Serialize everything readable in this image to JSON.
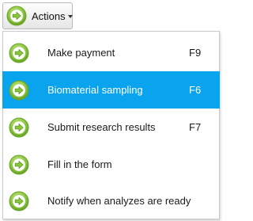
{
  "actions_button": {
    "label": "Actions",
    "icon": "arrow-right-circle-icon"
  },
  "menu": {
    "items": [
      {
        "label": "Make payment",
        "shortcut": "F9",
        "icon": "arrow-right-circle-icon",
        "highlighted": false
      },
      {
        "label": "Biomaterial sampling",
        "shortcut": "F6",
        "icon": "arrow-right-circle-icon",
        "highlighted": true
      },
      {
        "label": "Submit research results",
        "shortcut": "F7",
        "icon": "arrow-right-circle-icon",
        "highlighted": false
      },
      {
        "label": "Fill in the form",
        "shortcut": "",
        "icon": "arrow-right-circle-icon",
        "highlighted": false
      },
      {
        "label": "Notify when analyzes are ready",
        "shortcut": "",
        "icon": "arrow-right-circle-icon",
        "highlighted": false
      }
    ]
  },
  "colors": {
    "highlight": "#0aa3ee",
    "icon_green": "#8cc63f",
    "icon_green_dark": "#5e9a1e"
  }
}
